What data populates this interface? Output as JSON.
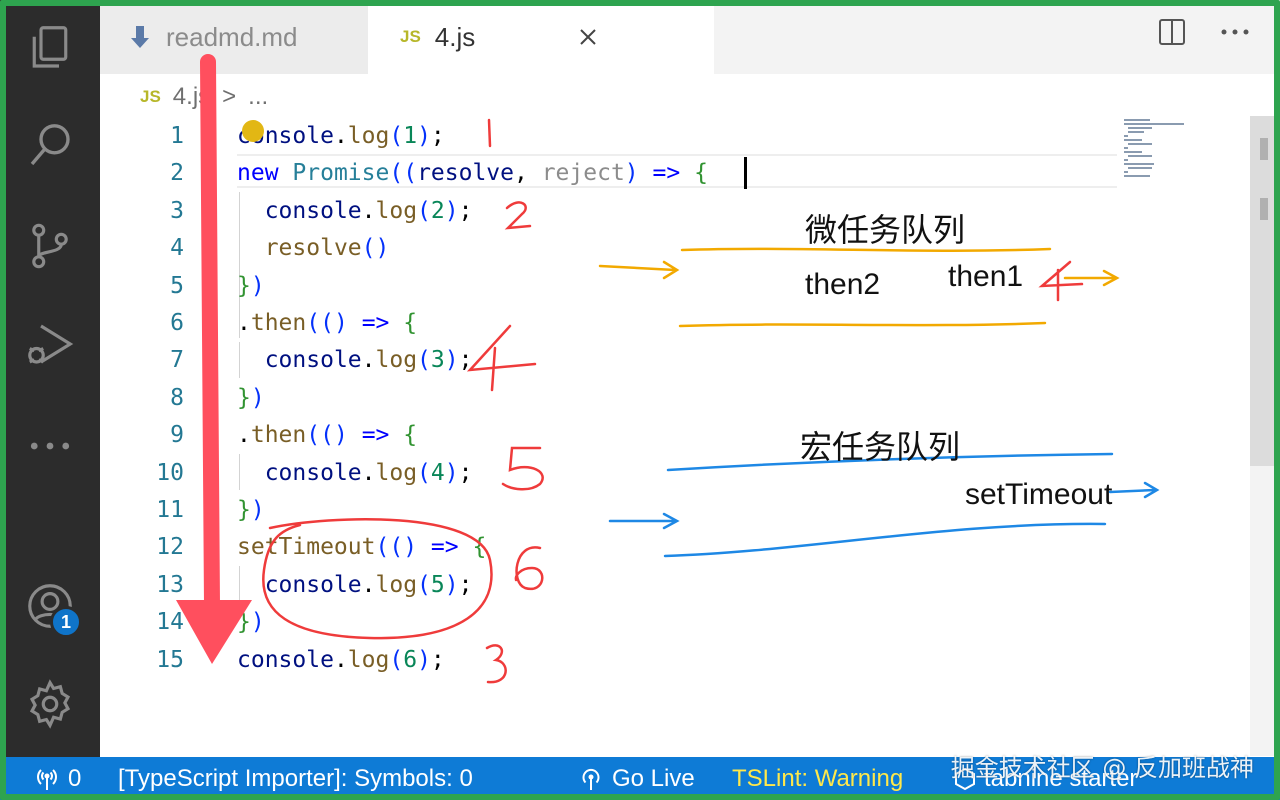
{
  "tabs": [
    {
      "label": "readmd.md",
      "icon": "markdown-download-icon"
    },
    {
      "label": "4.js",
      "type_tag": "JS",
      "close": "close-icon"
    }
  ],
  "breadcrumb": {
    "tag": "JS",
    "file": "4.js",
    "sep": ">",
    "more": "..."
  },
  "code": [
    {
      "n": "1",
      "text": "console.log(1);"
    },
    {
      "n": "2",
      "text": "new Promise((resolve, reject) => {"
    },
    {
      "n": "3",
      "text": "  console.log(2);"
    },
    {
      "n": "4",
      "text": "  resolve()"
    },
    {
      "n": "5",
      "text": "})"
    },
    {
      "n": "6",
      "text": ".then(() => {"
    },
    {
      "n": "7",
      "text": "  console.log(3);"
    },
    {
      "n": "8",
      "text": "})"
    },
    {
      "n": "9",
      "text": ".then(() => {"
    },
    {
      "n": "10",
      "text": "  console.log(4);"
    },
    {
      "n": "11",
      "text": "})"
    },
    {
      "n": "12",
      "text": "setTimeout(() => {"
    },
    {
      "n": "13",
      "text": "  console.log(5);"
    },
    {
      "n": "14",
      "text": "})"
    },
    {
      "n": "15",
      "text": "console.log(6);"
    }
  ],
  "annotations": {
    "micro_title": "微任务队列",
    "micro_items": [
      "then2",
      "then1"
    ],
    "macro_title": "宏任务队列",
    "macro_items": [
      "setTimeout"
    ]
  },
  "activity": {
    "badge": "1"
  },
  "statusbar": {
    "remote": "0",
    "importer": "[TypeScript Importer]: Symbols: 0",
    "golive": "Go Live",
    "tslint": "TSLint: Warning",
    "tabnine": "tabnine starter"
  },
  "watermark": "掘金技术社区 @ 反加班战神",
  "colors": {
    "status": "#0e7bd6",
    "activity": "#2c2c2c",
    "frame": "#2ea44f",
    "anno_red": "#ef3b3b",
    "anno_orange": "#f2a900",
    "anno_blue": "#1e88e5"
  }
}
